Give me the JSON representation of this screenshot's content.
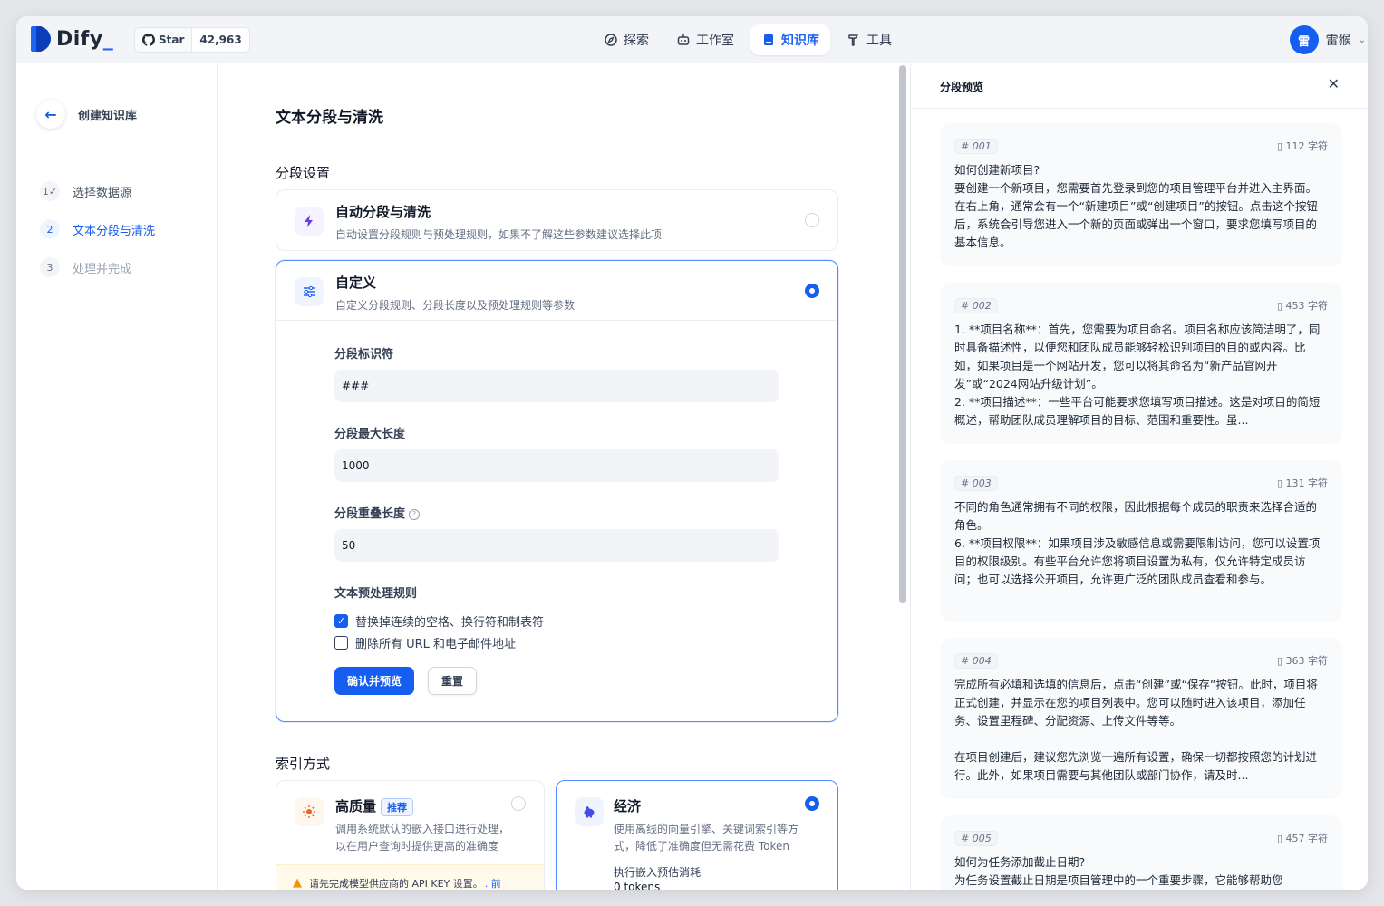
{
  "brand": {
    "name": "Dify",
    "accent": "#1c64f2"
  },
  "github": {
    "star_label": "Star",
    "stars": "42,963"
  },
  "nav": [
    {
      "label": "探索",
      "icon": "compass-icon",
      "active": false
    },
    {
      "label": "工作室",
      "icon": "robot-icon",
      "active": false
    },
    {
      "label": "知识库",
      "icon": "book-icon",
      "active": true
    },
    {
      "label": "工具",
      "icon": "hammer-icon",
      "active": false
    }
  ],
  "user": {
    "avatar": "雷",
    "name": "雷猴"
  },
  "sidebar": {
    "back_title": "创建知识库",
    "steps": [
      {
        "num": "1",
        "label": "选择数据源",
        "state": "done"
      },
      {
        "num": "2",
        "label": "文本分段与清洗",
        "state": "active"
      },
      {
        "num": "3",
        "label": "处理并完成",
        "state": "pending"
      }
    ]
  },
  "main": {
    "title": "文本分段与清洗",
    "segment_section": "分段设置",
    "auto": {
      "title": "自动分段与清洗",
      "desc": "自动设置分段规则与预处理规则，如果不了解这些参数建议选择此项"
    },
    "custom": {
      "title": "自定义",
      "desc": "自定义分段规则、分段长度以及预处理规则等参数",
      "separator_label": "分段标识符",
      "separator_value": "###",
      "max_len_label": "分段最大长度",
      "max_len_value": "1000",
      "overlap_label": "分段重叠长度",
      "overlap_value": "50",
      "rules_label": "文本预处理规则",
      "rule1": "替换掉连续的空格、换行符和制表符",
      "rule1_checked": true,
      "rule2": "删除所有 URL 和电子邮件地址",
      "rule2_checked": false,
      "confirm_btn": "确认并预览",
      "reset_btn": "重置"
    },
    "index_section": "索引方式",
    "high_quality": {
      "title": "高质量",
      "badge": "推荐",
      "desc1": "调用系统默认的嵌入接口进行处理，",
      "desc2": "以在用户查询时提供更高的准确度",
      "warning": "请先完成模型供应商的 API KEY 设置。",
      "warning_link": ". 前"
    },
    "economy": {
      "title": "经济",
      "desc1": "使用离线的向量引擎、关键词索引等方",
      "desc2": "式，降低了准确度但无需花费 Token",
      "cost_label": "执行嵌入预估消耗",
      "cost_value": "0 tokens"
    }
  },
  "preview": {
    "title": "分段预览",
    "segments": [
      {
        "id": "# 001",
        "count": "112 字符",
        "text": "如何创建新项目?\n要创建一个新项目，您需要首先登录到您的项目管理平台并进入主界面。在右上角，通常会有一个“新建项目”或“创建项目”的按钮。点击这个按钮后，系统会引导您进入一个新的页面或弹出一个窗口，要求您填写项目的基本信息。"
      },
      {
        "id": "# 002",
        "count": "453 字符",
        "text": "1. **项目名称**：首先，您需要为项目命名。项目名称应该简洁明了，同时具备描述性，以便您和团队成员能够轻松识别项目的目的或内容。比如，如果项目是一个网站开发，您可以将其命名为“新产品官网开发”或“2024网站升级计划”。\n2. **项目描述**：一些平台可能要求您填写项目描述。这是对项目的简短概述，帮助团队成员理解项目的目标、范围和重要性。虽..."
      },
      {
        "id": "# 003",
        "count": "131 字符",
        "text": "不同的角色通常拥有不同的权限，因此根据每个成员的职责来选择合适的角色。\n6. **项目权限**：如果项目涉及敏感信息或需要限制访问，您可以设置项目的权限级别。有些平台允许您将项目设置为私有，仅允许特定成员访问；也可以选择公开项目，允许更广泛的团队成员查看和参与。"
      },
      {
        "id": "# 004",
        "count": "363 字符",
        "text": "完成所有必填和选填的信息后，点击“创建”或“保存”按钮。此时，项目将正式创建，并显示在您的项目列表中。您可以随时进入该项目，添加任务、设置里程碑、分配资源、上传文件等等。\n\n在项目创建后，建议您先浏览一遍所有设置，确保一切都按照您的计划进行。此外，如果项目需要与其他团队或部门协作，请及时..."
      },
      {
        "id": "# 005",
        "count": "457 字符",
        "text": "如何为任务添加截止日期?\n为任务设置截止日期是项目管理中的一个重要步骤，它能够帮助您"
      }
    ]
  }
}
